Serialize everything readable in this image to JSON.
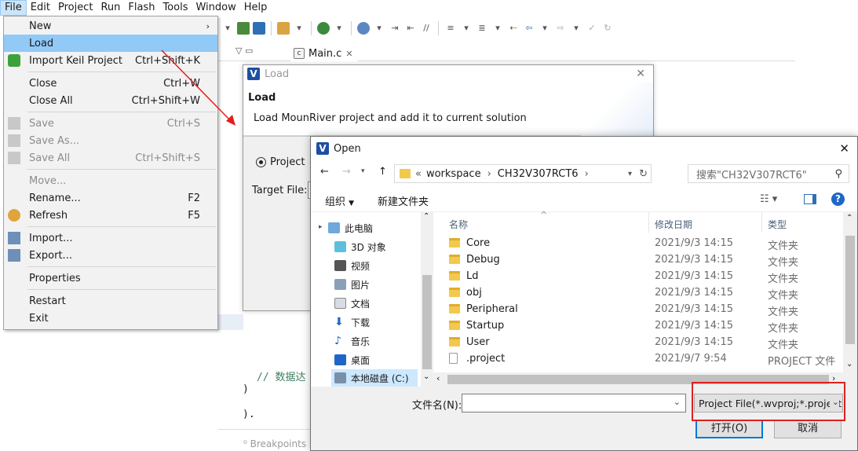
{
  "menubar": [
    "File",
    "Edit",
    "Project",
    "Run",
    "Flash",
    "Tools",
    "Window",
    "Help"
  ],
  "file_menu": {
    "new": "New",
    "load": "Load",
    "import_keil": "Import Keil Project",
    "import_keil_sc": "Ctrl+Shift+K",
    "close": "Close",
    "close_sc": "Ctrl+W",
    "close_all": "Close All",
    "close_all_sc": "Ctrl+Shift+W",
    "save": "Save",
    "save_sc": "Ctrl+S",
    "save_as": "Save As...",
    "save_all": "Save All",
    "save_all_sc": "Ctrl+Shift+S",
    "move": "Move...",
    "rename": "Rename...",
    "rename_sc": "F2",
    "refresh": "Refresh",
    "refresh_sc": "F5",
    "import": "Import...",
    "export": "Export...",
    "properties": "Properties",
    "restart": "Restart",
    "exit": "Exit"
  },
  "editor": {
    "tab": "Main.c",
    "comment": "// 数据达",
    "bottom_tab": "Breakpoints"
  },
  "load_dialog": {
    "title": "Load",
    "heading": "Load",
    "description": "Load MounRiver project and add it to current solution",
    "radio_label": "Project",
    "target_label": "Target File:"
  },
  "open_dialog": {
    "title": "Open",
    "path": [
      "workspace",
      "CH32V307RCT6"
    ],
    "search_placeholder": "搜索\"CH32V307RCT6\"",
    "organize": "组织",
    "new_folder": "新建文件夹",
    "nav": [
      "此电脑",
      "3D 对象",
      "视频",
      "图片",
      "文档",
      "下载",
      "音乐",
      "桌面",
      "本地磁盘 (C:)"
    ],
    "columns": {
      "name": "名称",
      "date": "修改日期",
      "type": "类型"
    },
    "files": [
      {
        "name": "Core",
        "date": "2021/9/3 14:15",
        "type": "文件夹"
      },
      {
        "name": "Debug",
        "date": "2021/9/3 14:15",
        "type": "文件夹"
      },
      {
        "name": "Ld",
        "date": "2021/9/3 14:15",
        "type": "文件夹"
      },
      {
        "name": "obj",
        "date": "2021/9/3 14:15",
        "type": "文件夹"
      },
      {
        "name": "Peripheral",
        "date": "2021/9/3 14:15",
        "type": "文件夹"
      },
      {
        "name": "Startup",
        "date": "2021/9/3 14:15",
        "type": "文件夹"
      },
      {
        "name": "User",
        "date": "2021/9/3 14:15",
        "type": "文件夹"
      },
      {
        "name": ".project",
        "date": "2021/9/7 9:54",
        "type": "PROJECT 文件"
      }
    ],
    "filename_label": "文件名(N):",
    "filename_value": "",
    "filetype": "Project File(*.wvproj;*.project)",
    "open_btn": "打开(O)",
    "cancel_btn": "取消"
  },
  "colors": {
    "accent": "#91c9f7",
    "highlight": "#e0201c",
    "folder": "#f2c94c"
  }
}
